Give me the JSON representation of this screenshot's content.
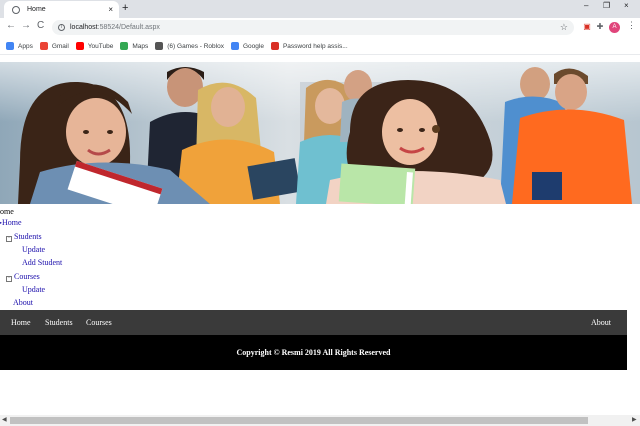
{
  "browser": {
    "tab_title": "Home",
    "tab_close": "×",
    "new_tab": "+",
    "window_controls": {
      "minimize": "–",
      "restore": "❐",
      "close": "×"
    },
    "back": "←",
    "forward": "→",
    "reload": "C",
    "url_host": "localhost",
    "url_path": ":58524/Default.aspx",
    "profile_initial": "A",
    "bookmarks": [
      {
        "label": "Apps",
        "icon": "apps-grid-icon",
        "color": "#4285f4"
      },
      {
        "label": "Gmail",
        "icon": "gmail-icon",
        "color": "#ea4335"
      },
      {
        "label": "YouTube",
        "icon": "youtube-icon",
        "color": "#ff0000"
      },
      {
        "label": "Maps",
        "icon": "maps-icon",
        "color": "#34a853"
      },
      {
        "label": "(6) Games - Roblox",
        "icon": "roblox-icon",
        "color": "#555555"
      },
      {
        "label": "Google",
        "icon": "google-icon",
        "color": "#4285f4"
      },
      {
        "label": "Password help assis...",
        "icon": "password-help-icon",
        "color": "#d93025"
      }
    ]
  },
  "page": {
    "breadcrumb_fragment": "ome",
    "tree": {
      "home": "Home",
      "students": "Students",
      "students_update": "Update",
      "add_student": "Add Student",
      "courses": "Courses",
      "courses_update": "Update",
      "about": "About"
    },
    "navbar": {
      "home": "Home",
      "students": "Students",
      "courses": "Courses",
      "about": "About"
    },
    "footer": "Copyright © Resmi 2019 All Rights Reserved"
  },
  "colors": {
    "navbar_bg": "#3a3a3a",
    "footer_bg": "#000000",
    "link": "#1a0dab"
  }
}
